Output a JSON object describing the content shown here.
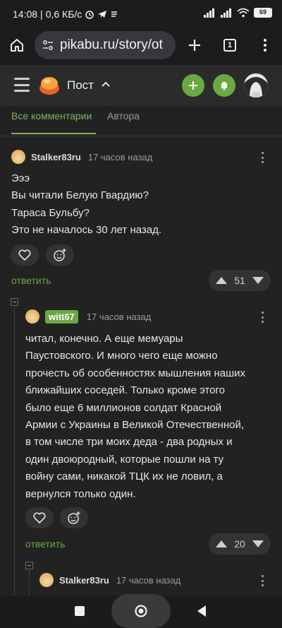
{
  "status_bar": {
    "time": "14:08",
    "network": "0,6 КБ/с",
    "battery": "69"
  },
  "browser": {
    "url": "pikabu.ru/story/ot",
    "tab_count": "1"
  },
  "header": {
    "title": "Пост"
  },
  "tabs": {
    "all": "Все комментарии",
    "author": "Автора"
  },
  "comments": [
    {
      "user": "Stalker83ru",
      "time": "17 часов назад",
      "text": "Эээ\nВы читали Белую Гвардию?\nТараса Бульбу?\nЭто не началось 30 лет назад.",
      "reply": "ответить",
      "rating": "51"
    },
    {
      "user": "witt67",
      "time": "17 часов назад",
      "text": "читал, конечно. А еще мемуары\nПаустовского. И много чего еще можно\nпрочесть об особенностях мышления наших\nближайших соседей. Только кроме этого\nбыло еще 6 миллионов солдат Красной\nАрмии с Украины в Великой Отечественной,\nв том числе три моих деда - два родных и\nодин двоюродный, которые пошли на ту\nвойну сами, никакой ТЦК их не ловил, а\nвернулся только один.",
      "reply": "ответить",
      "rating": "20"
    },
    {
      "user": "Stalker83ru",
      "time": "17 часов назад"
    }
  ],
  "colors": {
    "accent": "#6aa842",
    "background": "#222222",
    "surface": "#333333"
  }
}
